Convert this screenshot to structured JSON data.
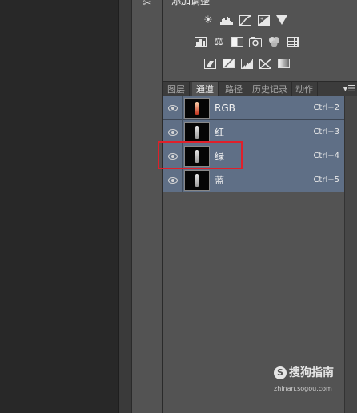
{
  "adjustments": {
    "title": "添加调整",
    "row1": [
      "brightness-icon",
      "levels-icon",
      "curves-icon",
      "exposure-icon",
      "vibrance-icon"
    ],
    "row2": [
      "hue-saturation-icon",
      "color-balance-icon",
      "black-white-icon",
      "photo-filter-icon",
      "channel-mixer-icon",
      "color-lookup-icon"
    ],
    "row3": [
      "invert-icon",
      "posterize-icon",
      "threshold-icon",
      "selective-color-icon",
      "gradient-map-icon"
    ]
  },
  "tabs": [
    {
      "label": "图层",
      "active": false
    },
    {
      "label": "通道",
      "active": true
    },
    {
      "label": "路径",
      "active": false
    },
    {
      "label": "历史记录",
      "active": false
    },
    {
      "label": "动作",
      "active": false
    }
  ],
  "channels": [
    {
      "name": "RGB",
      "shortcut": "Ctrl+2",
      "composite": true
    },
    {
      "name": "红",
      "shortcut": "Ctrl+3",
      "composite": false
    },
    {
      "name": "绿",
      "shortcut": "Ctrl+4",
      "composite": false
    },
    {
      "name": "蓝",
      "shortcut": "Ctrl+5",
      "composite": false
    }
  ],
  "watermark": {
    "brand": "搜狗指南",
    "url": "zhinan.sogou.com"
  },
  "colors": {
    "row_selected": "#5f6f86",
    "panel_bg": "#535353",
    "highlight": "#e0202a"
  }
}
